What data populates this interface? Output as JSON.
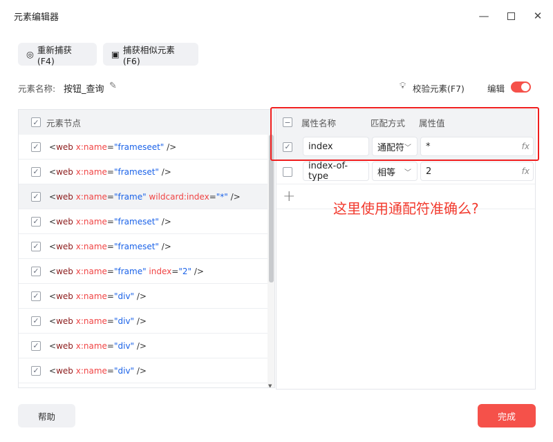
{
  "window": {
    "title": "元素编辑器"
  },
  "toolbar": {
    "recapture": "重新捕获(F4)",
    "capture_similar": "捕获相似元素(F6)"
  },
  "element_name": {
    "label": "元素名称:",
    "value": "按钮_查询"
  },
  "validate": "校验元素(F7)",
  "edit": {
    "label": "编辑",
    "enabled": true
  },
  "nodes": {
    "header": "元素节点",
    "items": [
      {
        "el": "web",
        "attr": "x:name",
        "val": "\"frameseet\"",
        "extra_attr": "",
        "extra_val": ""
      },
      {
        "el": "web",
        "attr": "x:name",
        "val": "\"frameset\"",
        "extra_attr": "",
        "extra_val": ""
      },
      {
        "el": "web",
        "attr": "x:name",
        "val": "\"frame\"",
        "extra_attr": "wildcard:index",
        "extra_val": "\"*\""
      },
      {
        "el": "web",
        "attr": "x:name",
        "val": "\"frameset\"",
        "extra_attr": "",
        "extra_val": ""
      },
      {
        "el": "web",
        "attr": "x:name",
        "val": "\"frameset\"",
        "extra_attr": "",
        "extra_val": ""
      },
      {
        "el": "web",
        "attr": "x:name",
        "val": "\"frame\"",
        "extra_attr": "index",
        "extra_val": "\"2\""
      },
      {
        "el": "web",
        "attr": "x:name",
        "val": "\"div\"",
        "extra_attr": "",
        "extra_val": ""
      },
      {
        "el": "web",
        "attr": "x:name",
        "val": "\"div\"",
        "extra_attr": "",
        "extra_val": ""
      },
      {
        "el": "web",
        "attr": "x:name",
        "val": "\"div\"",
        "extra_attr": "",
        "extra_val": ""
      },
      {
        "el": "web",
        "attr": "x:name",
        "val": "\"div\"",
        "extra_attr": "",
        "extra_val": ""
      }
    ]
  },
  "attributes": {
    "headers": {
      "name": "属性名称",
      "match": "匹配方式",
      "value": "属性值"
    },
    "rows": [
      {
        "checked": true,
        "name": "index",
        "match": "通配符",
        "value": "*",
        "fx": "fx"
      },
      {
        "checked": false,
        "name": "index-of-type",
        "match": "相等",
        "value": "2",
        "fx": "fx"
      }
    ]
  },
  "annotation": "这里使用通配符准确么?",
  "footer": {
    "help": "帮助",
    "done": "完成"
  },
  "colors": {
    "accent": "#f5514a",
    "annotation": "#f23a2e"
  }
}
